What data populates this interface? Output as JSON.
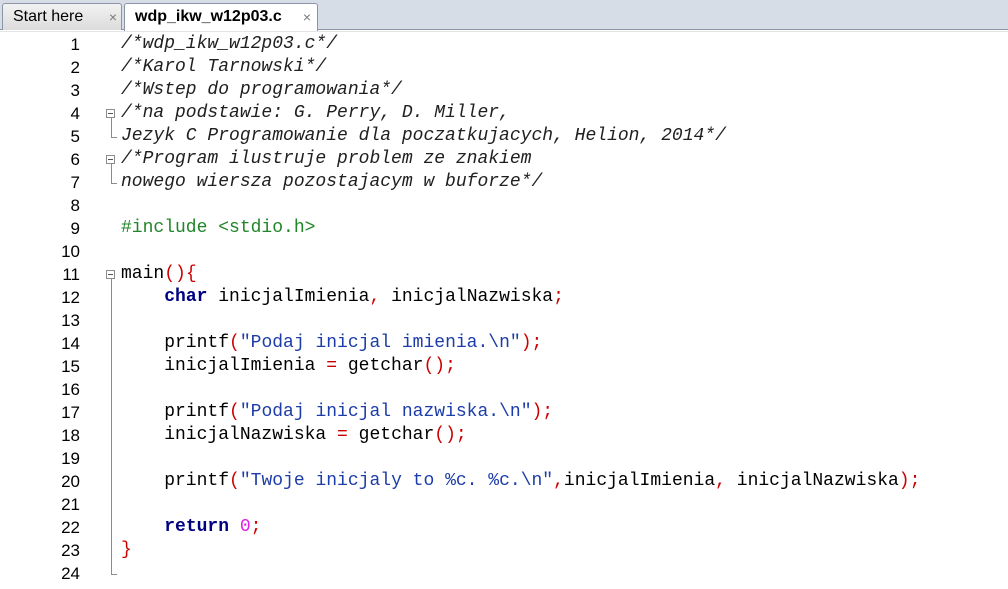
{
  "tabs": [
    {
      "label": "Start here",
      "active": false
    },
    {
      "label": "wdp_ikw_w12p03.c",
      "active": true
    }
  ],
  "close_glyph": "×",
  "lines": [
    {
      "n": "1",
      "segments": [
        {
          "t": "/*wdp_ikw_w12p03.c*/",
          "c": "cm"
        }
      ]
    },
    {
      "n": "2",
      "segments": [
        {
          "t": "/*Karol Tarnowski*/",
          "c": "cm"
        }
      ]
    },
    {
      "n": "3",
      "segments": [
        {
          "t": "/*Wstep do programowania*/",
          "c": "cm"
        }
      ]
    },
    {
      "n": "4",
      "segments": [
        {
          "t": "/*na podstawie: G. Perry, D. Miller,",
          "c": "cm"
        }
      ]
    },
    {
      "n": "5",
      "segments": [
        {
          "t": "Jezyk C Programowanie dla poczatkujacych, Helion, 2014*/",
          "c": "cm"
        }
      ]
    },
    {
      "n": "6",
      "segments": [
        {
          "t": "/*Program ilustruje problem ze znakiem",
          "c": "cm"
        }
      ]
    },
    {
      "n": "7",
      "segments": [
        {
          "t": "nowego wiersza pozostajacym w buforze*/",
          "c": "cm"
        }
      ]
    },
    {
      "n": "8",
      "segments": []
    },
    {
      "n": "9",
      "segments": [
        {
          "t": "#include <stdio.h>",
          "c": "pp"
        }
      ]
    },
    {
      "n": "10",
      "segments": []
    },
    {
      "n": "11",
      "segments": [
        {
          "t": "main",
          "c": ""
        },
        {
          "t": "(){",
          "c": "op"
        }
      ]
    },
    {
      "n": "12",
      "segments": [
        {
          "t": "    ",
          "c": ""
        },
        {
          "t": "char",
          "c": "kw"
        },
        {
          "t": " inicjalImienia",
          "c": ""
        },
        {
          "t": ",",
          "c": "op"
        },
        {
          "t": " inicjalNazwiska",
          "c": ""
        },
        {
          "t": ";",
          "c": "op"
        }
      ]
    },
    {
      "n": "13",
      "segments": []
    },
    {
      "n": "14",
      "segments": [
        {
          "t": "    printf",
          "c": ""
        },
        {
          "t": "(",
          "c": "op"
        },
        {
          "t": "\"Podaj inicjal imienia.\\n\"",
          "c": "str"
        },
        {
          "t": ");",
          "c": "op"
        }
      ]
    },
    {
      "n": "15",
      "segments": [
        {
          "t": "    inicjalImienia ",
          "c": ""
        },
        {
          "t": "=",
          "c": "op"
        },
        {
          "t": " getchar",
          "c": ""
        },
        {
          "t": "();",
          "c": "op"
        }
      ]
    },
    {
      "n": "16",
      "segments": []
    },
    {
      "n": "17",
      "segments": [
        {
          "t": "    printf",
          "c": ""
        },
        {
          "t": "(",
          "c": "op"
        },
        {
          "t": "\"Podaj inicjal nazwiska.\\n\"",
          "c": "str"
        },
        {
          "t": ");",
          "c": "op"
        }
      ]
    },
    {
      "n": "18",
      "segments": [
        {
          "t": "    inicjalNazwiska ",
          "c": ""
        },
        {
          "t": "=",
          "c": "op"
        },
        {
          "t": " getchar",
          "c": ""
        },
        {
          "t": "();",
          "c": "op"
        }
      ]
    },
    {
      "n": "19",
      "segments": []
    },
    {
      "n": "20",
      "segments": [
        {
          "t": "    printf",
          "c": ""
        },
        {
          "t": "(",
          "c": "op"
        },
        {
          "t": "\"Twoje inicjaly to %c. %c.\\n\"",
          "c": "str"
        },
        {
          "t": ",",
          "c": "op"
        },
        {
          "t": "inicjalImienia",
          "c": ""
        },
        {
          "t": ",",
          "c": "op"
        },
        {
          "t": " inicjalNazwiska",
          "c": ""
        },
        {
          "t": ");",
          "c": "op"
        }
      ]
    },
    {
      "n": "21",
      "segments": []
    },
    {
      "n": "22",
      "segments": [
        {
          "t": "    ",
          "c": ""
        },
        {
          "t": "return",
          "c": "kw"
        },
        {
          "t": " ",
          "c": ""
        },
        {
          "t": "0",
          "c": "numlit"
        },
        {
          "t": ";",
          "c": "op"
        }
      ]
    },
    {
      "n": "23",
      "segments": [
        {
          "t": "}",
          "c": "op"
        }
      ]
    },
    {
      "n": "24",
      "segments": []
    }
  ]
}
